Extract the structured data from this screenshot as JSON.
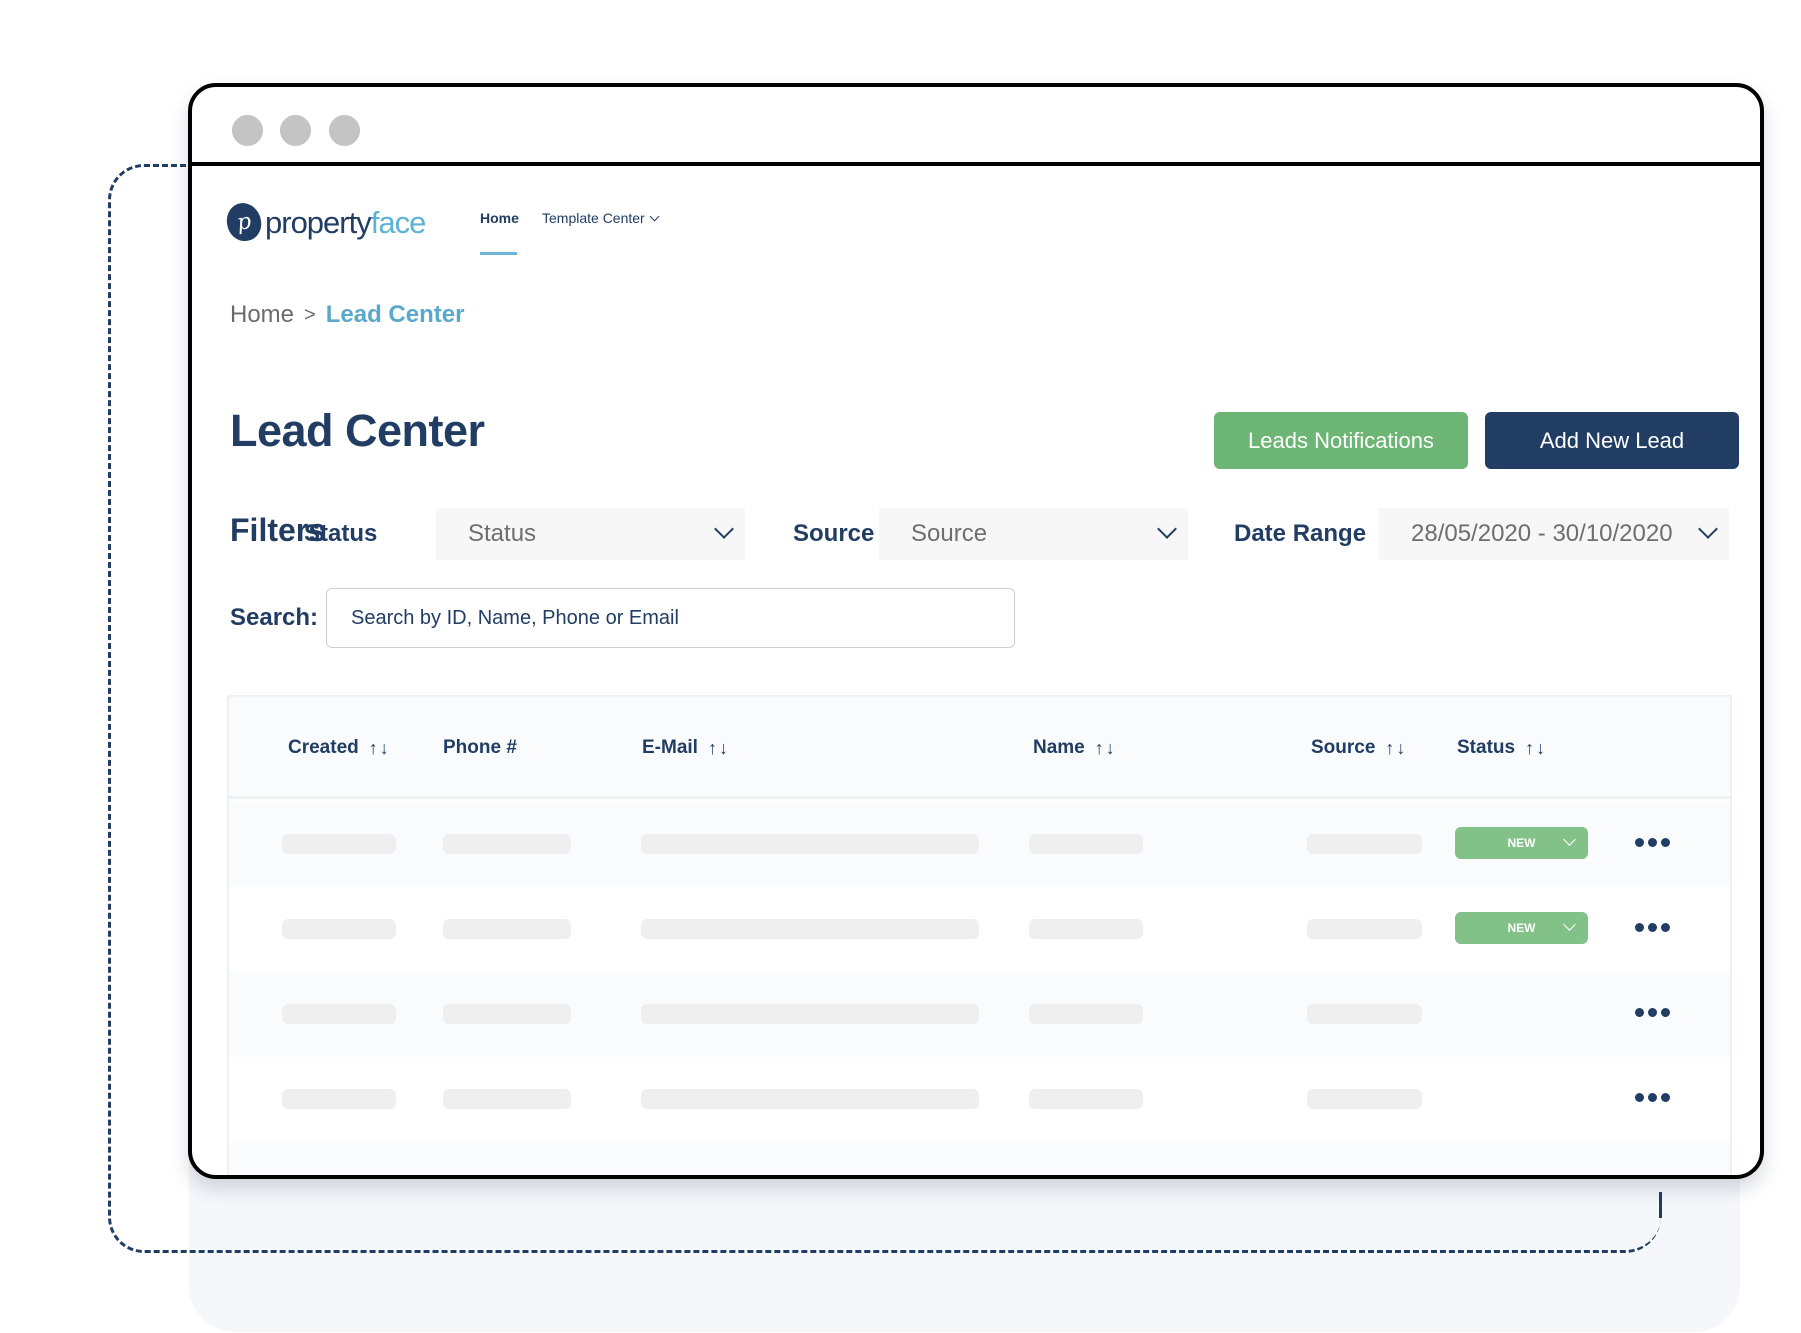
{
  "window": {
    "control_dots": [
      "window-dot-1",
      "window-dot-2",
      "window-dot-3"
    ]
  },
  "brand": {
    "logo_mark": "p",
    "name_part1": "property",
    "name_part2": "face",
    "colors": {
      "primary": "#213d63",
      "accent": "#5db3d5"
    }
  },
  "nav": {
    "items": [
      {
        "label": "Home",
        "active": true
      },
      {
        "label": "Template Center",
        "has_dropdown": true
      }
    ]
  },
  "breadcrumb": {
    "items": [
      "Home",
      "Lead Center"
    ],
    "separator": ">"
  },
  "page": {
    "title": "Lead Center"
  },
  "actions": {
    "notifications_label": "Leads Notifications",
    "add_label": "Add New Lead",
    "notifications_color": "#6db574",
    "add_color": "#213d63"
  },
  "filters": {
    "heading": "Filters",
    "status": {
      "label": "Status",
      "value": "Status"
    },
    "source": {
      "label": "Source",
      "value": "Source"
    },
    "date_range": {
      "label": "Date Range",
      "value": "28/05/2020 - 30/10/2020"
    }
  },
  "search": {
    "label": "Search:",
    "placeholder": "Search by ID, Name, Phone or Email",
    "value": ""
  },
  "table": {
    "columns": [
      {
        "label": "Created",
        "sortable": true
      },
      {
        "label": "Phone #",
        "sortable": false
      },
      {
        "label": "E-Mail",
        "sortable": true
      },
      {
        "label": "Name",
        "sortable": true
      },
      {
        "label": "Source",
        "sortable": true
      },
      {
        "label": "Status",
        "sortable": true
      }
    ],
    "sort_icon": "sort-up-down-icon",
    "rows": [
      {
        "loading": true,
        "status": "NEW",
        "actions_icon": "more-horizontal-icon"
      },
      {
        "loading": true,
        "status": "NEW",
        "actions_icon": "more-horizontal-icon"
      },
      {
        "loading": true,
        "status": null,
        "actions_icon": "more-horizontal-icon"
      },
      {
        "loading": true,
        "status": null,
        "actions_icon": "more-horizontal-icon"
      }
    ],
    "status_badge_color": "#82c188"
  }
}
